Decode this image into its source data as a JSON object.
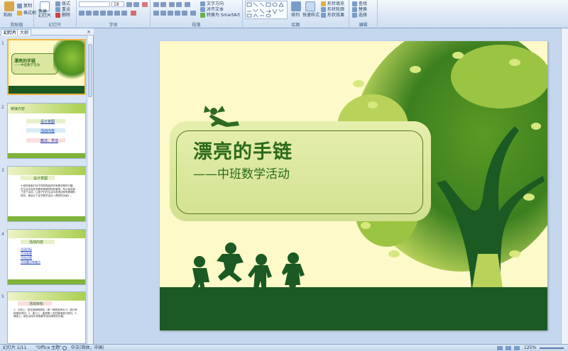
{
  "ribbon": {
    "groups": {
      "clipboard": "剪贴板",
      "slides": "幻灯片",
      "font": "字体",
      "paragraph": "段落",
      "drawing": "绘图",
      "editing": "编辑"
    },
    "paste": "粘贴",
    "copy": "复制",
    "format_painter": "格式刷",
    "new_slide": "新建\n幻灯片",
    "layout": "版式",
    "reset": "重设",
    "delete": "删除",
    "font_size": "18",
    "text_direction": "文字方向",
    "align_text": "对齐文本",
    "smartart": "转换为 SmartArt",
    "arrange": "排列",
    "quick_styles": "快速样式",
    "shape_fill": "形状填充",
    "shape_outline": "形状轮廓",
    "shape_effects": "形状效果",
    "find": "查找",
    "replace": "替换",
    "select": "选择"
  },
  "leftpane": {
    "tab_slides": "幻灯片",
    "tab_outline": "大纲",
    "close": "×",
    "thumbs": [
      {
        "num": "1",
        "title": "漂亮的手链",
        "subtitle": "——中班数学活动"
      },
      {
        "num": "2",
        "heading": "链接内容",
        "items": [
          "设计意图",
          "活动内容",
          "教法、学法"
        ]
      },
      {
        "num": "3",
        "heading": "设计意图",
        "body": "小班的宝宝们对不同的物品排列有着浓厚的兴趣，在生活中处处有着有规律排列的事物。所以我选择了这个活动，让孩子们在生活中发现这种有规律的排列，我设计了这节数学活动《漂亮的手链》。"
      },
      {
        "num": "4",
        "heading": "活动内容",
        "items": [
          "活动目标",
          "活动准备",
          "活动过程",
          "活动重点和难点"
        ]
      },
      {
        "num": "5",
        "heading": "活动目标",
        "body": "1、认知上：尝试用两种颜色（或一种颜色两大小）进行有规律的排列。2、能力上：能按照一定的规律进行排列。3、情感上：能在活动中体验数学活动带来的乐趣。"
      }
    ]
  },
  "slide": {
    "title": "漂亮的手链",
    "subtitle": "——中班数学活动"
  },
  "status": {
    "slide_info": "幻灯片 1/11",
    "theme": "\"Office 主题\"",
    "language": "中文(简体，中国)",
    "zoom": "125%"
  },
  "colors": {
    "title_green": "#2a6a1a",
    "slide_bg": "#fdf9c8",
    "ground": "#1b5a23",
    "leaf_light": "#b9d35a",
    "leaf_dark": "#3c7f1f"
  }
}
